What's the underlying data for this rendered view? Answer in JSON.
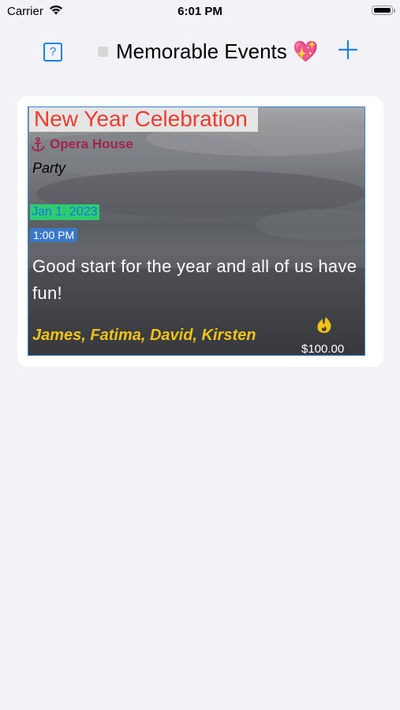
{
  "status_bar": {
    "carrier": "Carrier",
    "time": "6:01 PM",
    "icons": [
      "wifi-icon",
      "battery-icon"
    ]
  },
  "nav": {
    "help_label": "?",
    "title": "Memorable Events 💖",
    "add_icon": "plus-icon",
    "accent_color": "#1a7ff0"
  },
  "events": [
    {
      "title": "New Year Celebration",
      "location": "Opera House",
      "category": "Party",
      "date": "Jan 1, 2023",
      "time": "1:00 PM",
      "description": "Good start for the year and all of us have fun!",
      "participants": "James, Fatima, David, Kirsten",
      "price": "$100.00",
      "title_color": "#ee3b2f",
      "location_color": "#a0244a",
      "participants_color": "#f2c316"
    }
  ]
}
